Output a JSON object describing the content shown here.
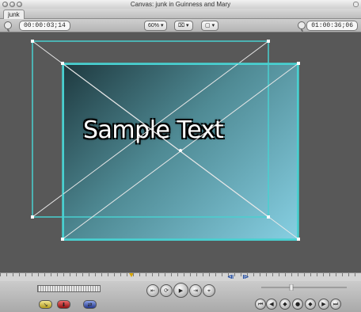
{
  "window": {
    "title": "Canvas: junk in Guinness and Mary"
  },
  "tabs": [
    {
      "label": "junk"
    }
  ],
  "toolbar": {
    "timecode_left": "00:00:03;14",
    "zoom": "60%",
    "timecode_right": "01:00:36;06"
  },
  "canvas": {
    "sample_text": "Sample Text"
  },
  "colors": {
    "wireframe_cyan": "#49d0d0",
    "background": "#585858",
    "image_dark": "#1f3a40",
    "image_light": "#86cfe2"
  },
  "icons": {
    "close": "circle-close-icon",
    "minimize": "circle-minimize-icon",
    "zoom": "circle-zoom-icon",
    "clock_left": "clock-icon",
    "clock_right": "clock-icon",
    "view_mode": "view-mode-icon",
    "overlay": "overlay-icon",
    "play_in_to_out": "play-in-to-out-icon",
    "play_around": "play-around-current-icon",
    "play": "play-icon",
    "play_to_out": "play-to-out-icon",
    "mark_clip": "mark-clip-icon",
    "insert_edit": "insert-edit-icon",
    "overwrite_edit": "overwrite-edit-icon",
    "replace_edit": "replace-edit-icon",
    "prev_edit": "previous-edit-icon",
    "mark_in": "mark-in-icon",
    "add_marker": "add-marker-icon",
    "mark_out": "mark-out-icon",
    "next_edit": "next-edit-icon"
  }
}
